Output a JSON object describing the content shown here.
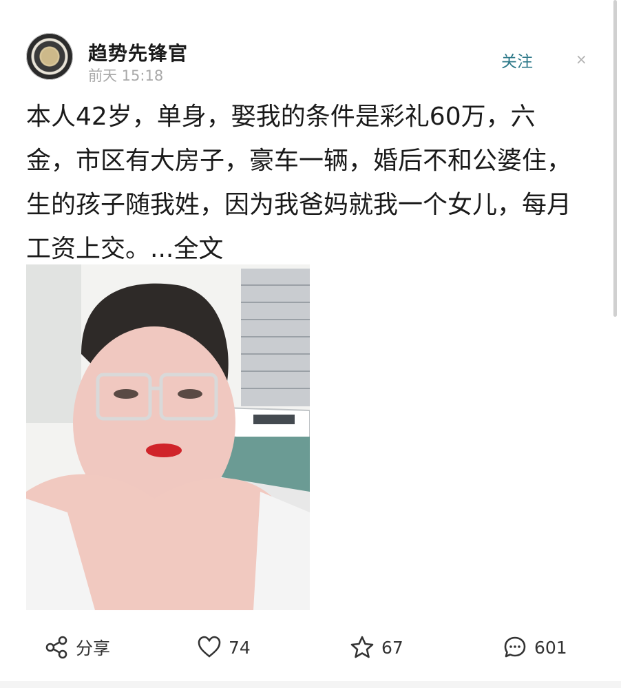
{
  "post": {
    "username": "趋势先锋官",
    "timestamp": "前天 15:18",
    "follow_label": "关注",
    "close_label": "×",
    "text": "本人42岁，单身，娶我的条件是彩礼60万，六金，市区有大房子，豪车一辆，婚后不和公婆住，生的孩子随我姓，因为我爸妈就我一个女儿，每月工资上交。",
    "full_text_label": "...全文"
  },
  "actions": {
    "share_label": "分享",
    "likes": "74",
    "favorites": "67",
    "comments": "601"
  },
  "icons": {
    "share": "share-icon",
    "like": "heart-icon",
    "favorite": "star-icon",
    "comment": "comment-icon"
  },
  "colors": {
    "follow": "#2f7a8a",
    "timestamp": "#a8a8a8"
  }
}
